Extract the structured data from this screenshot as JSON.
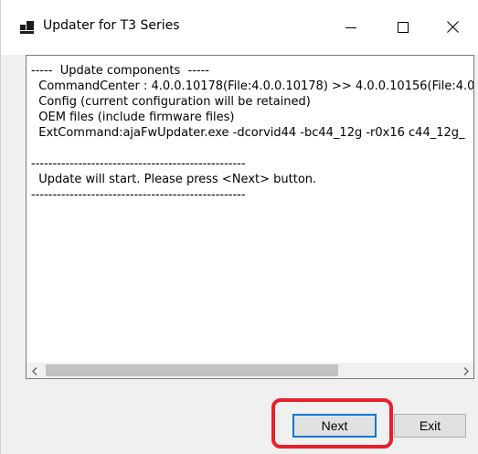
{
  "window": {
    "title": "Updater for T3 Series",
    "icon": "app-window-icon",
    "controls": {
      "minimize_icon": "minimize-icon",
      "maximize_icon": "maximize-icon",
      "close_icon": "close-icon"
    }
  },
  "log": {
    "lines": [
      "-----  Update components  -----",
      "  CommandCenter : 4.0.0.10178(File:4.0.0.10178) >> 4.0.0.10156(File:4.0.0",
      "  Config (current configuration will be retained)",
      "  OEM files (include firmware files)",
      "  ExtCommand:ajaFwUpdater.exe -dcorvid44 -bc44_12g -r0x16 c44_12g_",
      "",
      "--------------------------------------------------",
      "  Update will start. Please press <Next> button.",
      "--------------------------------------------------"
    ]
  },
  "buttons": {
    "next_label": "Next",
    "exit_label": "Exit"
  },
  "colors": {
    "highlight": "#e8202a",
    "focus_border": "#0078d7"
  }
}
